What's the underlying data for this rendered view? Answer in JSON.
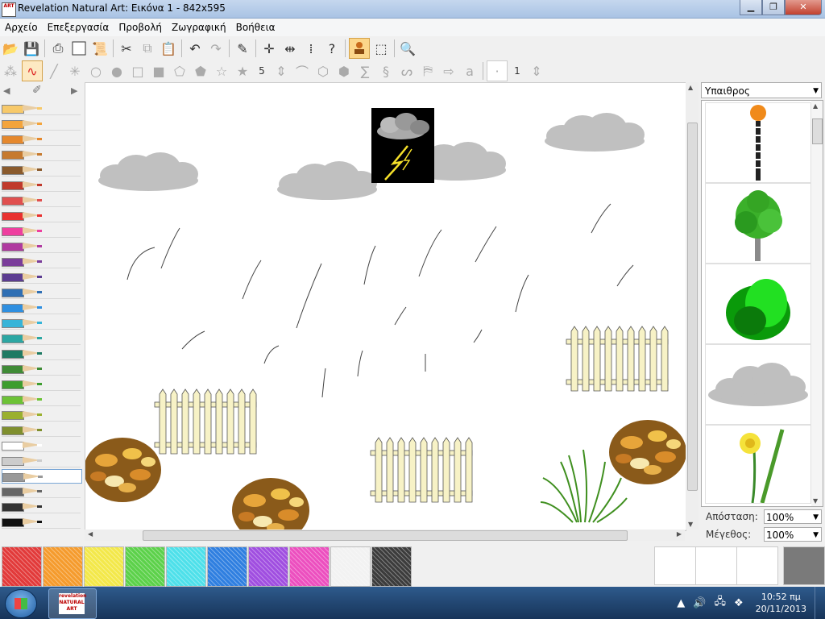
{
  "window": {
    "title": "Revelation Natural Art: Εικόνα 1 - 842x595",
    "app_icon_text": "ART",
    "minimize": "▁",
    "maximize": "❐",
    "close": "✕"
  },
  "menu": [
    "Αρχείο",
    "Επεξεργασία",
    "Προβολή",
    "Ζωγραφική",
    "Βοήθεια"
  ],
  "toolbar_main": [
    "open-icon",
    "save-icon",
    "print-icon",
    "new-page-icon",
    "scroll-icon",
    "cut-icon",
    "copy-icon",
    "paste-icon",
    "undo-icon",
    "redo-icon",
    "eyedropper-icon",
    "mirror-horizontal-icon",
    "mirror-vertical-icon",
    "symmetry-icon",
    "help-icon",
    "stamp-icon",
    "select-icon",
    "zoom-icon"
  ],
  "toolbar_shapes": {
    "line_width": "5",
    "point_size": "1"
  },
  "right_panel": {
    "category": "Υπαιθρος",
    "distance_label": "Απόσταση:",
    "distance_value": "100%",
    "size_label": "Μέγεθος:",
    "size_value": "100%",
    "thumbnails": [
      "lamp-post",
      "tree",
      "bush",
      "cloud",
      "daffodil"
    ]
  },
  "pencils": [
    "#f7c96a",
    "#f3a43c",
    "#e5882d",
    "#c67a2f",
    "#8a5a2c",
    "#c0392b",
    "#e0504f",
    "#e8312f",
    "#ee3f9f",
    "#b03aa0",
    "#7a3d9a",
    "#5c3d91",
    "#2f6fb4",
    "#2f8fe0",
    "#36b4d8",
    "#2ca7a3",
    "#1e7a63",
    "#3f8b36",
    "#3d9d2f",
    "#6cc236",
    "#9ab02f",
    "#7f8f2e",
    "#ffffff",
    "#cccccc",
    "#999999",
    "#666666",
    "#333333",
    "#111111"
  ],
  "palette": [
    "#e23a3a",
    "#f59b2d",
    "#f3e84a",
    "#5cd14a",
    "#4ee0ea",
    "#2f7fe0",
    "#a04ee0",
    "#ec4fbf",
    "#f2f2f2",
    "#3c3c3c"
  ],
  "taskbar": {
    "time": "10:52 πμ",
    "date": "20/11/2013",
    "app_text": "revelation NATURAL ART"
  }
}
